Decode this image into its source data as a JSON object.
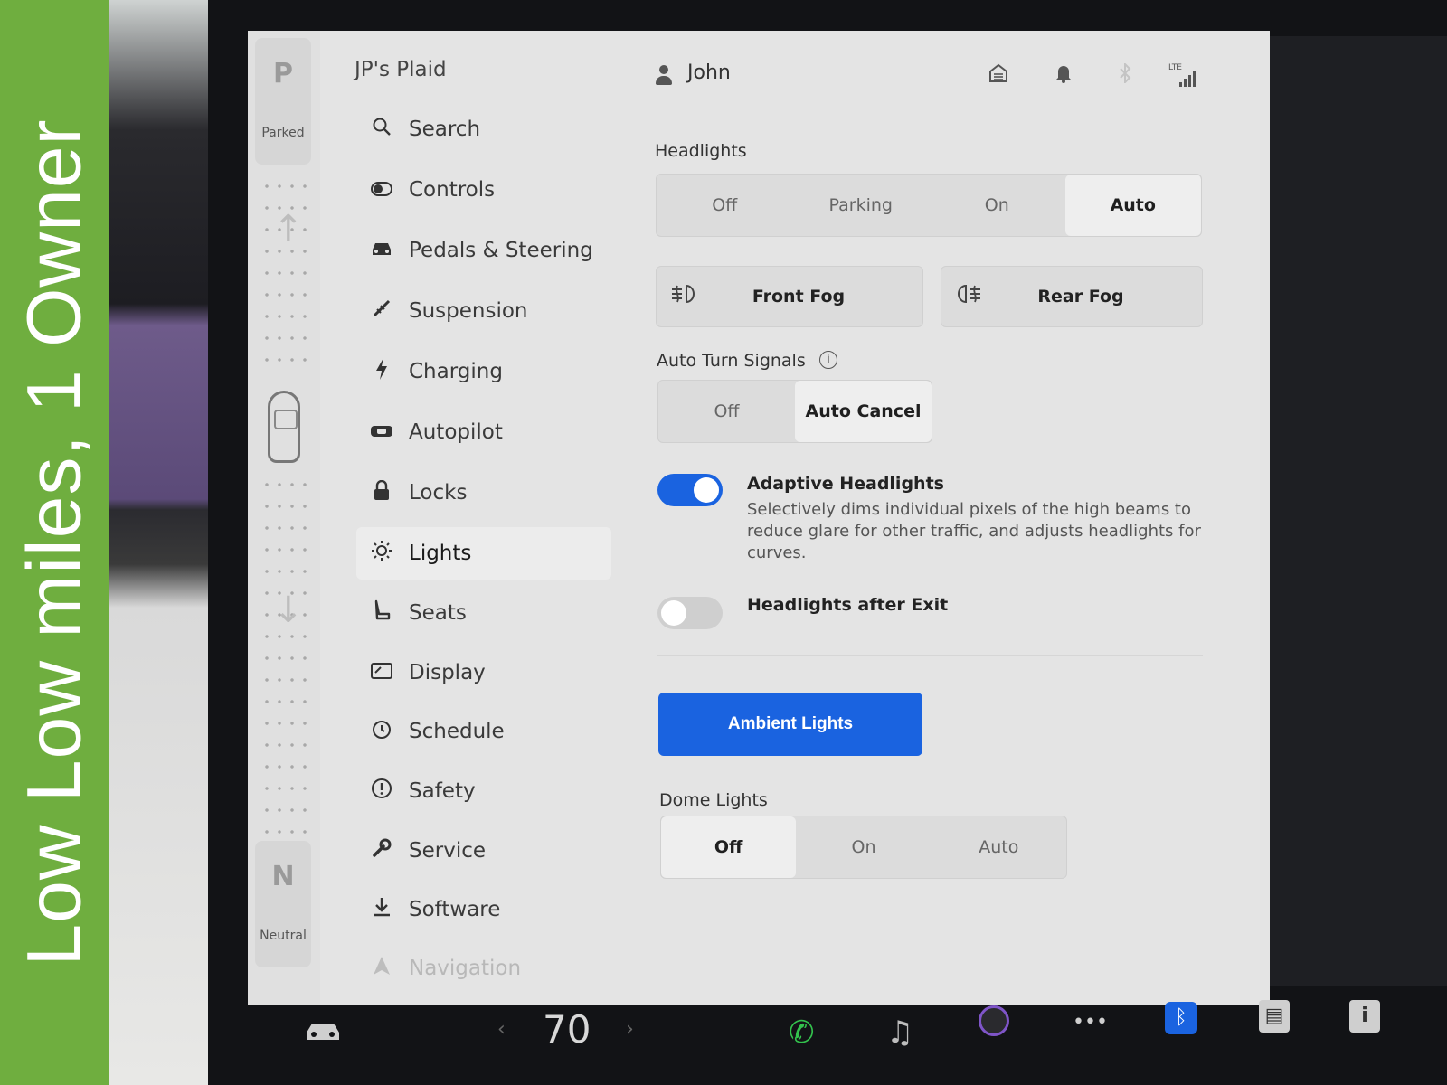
{
  "overlay": {
    "banner_text": "Low Low miles,   1 Owner"
  },
  "gear": {
    "top_letter": "P",
    "top_label": "Parked",
    "bottom_letter": "N",
    "bottom_label": "Neutral"
  },
  "sidebar": {
    "car_name": "JP's Plaid",
    "items": [
      {
        "label": "Search",
        "icon": "search-icon"
      },
      {
        "label": "Controls",
        "icon": "toggle-icon"
      },
      {
        "label": "Pedals & Steering",
        "icon": "car-icon"
      },
      {
        "label": "Suspension",
        "icon": "wrench-icon"
      },
      {
        "label": "Charging",
        "icon": "bolt-icon"
      },
      {
        "label": "Autopilot",
        "icon": "steering-icon"
      },
      {
        "label": "Locks",
        "icon": "lock-icon"
      },
      {
        "label": "Lights",
        "icon": "sun-icon",
        "active": true
      },
      {
        "label": "Seats",
        "icon": "seat-icon"
      },
      {
        "label": "Display",
        "icon": "display-icon"
      },
      {
        "label": "Schedule",
        "icon": "clock-icon"
      },
      {
        "label": "Safety",
        "icon": "alert-icon"
      },
      {
        "label": "Service",
        "icon": "wrench-icon"
      },
      {
        "label": "Software",
        "icon": "download-icon"
      },
      {
        "label": "Navigation",
        "icon": "navigation-icon"
      }
    ]
  },
  "status": {
    "user_name": "John",
    "network_label": "LTE"
  },
  "headlights": {
    "title": "Headlights",
    "options": [
      "Off",
      "Parking",
      "On",
      "Auto"
    ],
    "selected": "Auto"
  },
  "fog": {
    "front_label": "Front Fog",
    "rear_label": "Rear Fog"
  },
  "turn_signals": {
    "title": "Auto Turn Signals",
    "options": [
      "Off",
      "Auto Cancel"
    ],
    "selected": "Auto Cancel"
  },
  "adaptive": {
    "title": "Adaptive Headlights",
    "description": "Selectively dims individual pixels of the high beams to reduce glare for other traffic, and adjusts headlights for curves.",
    "enabled": true
  },
  "after_exit": {
    "title": "Headlights after Exit",
    "enabled": false
  },
  "ambient": {
    "label": "Ambient Lights"
  },
  "dome": {
    "title": "Dome Lights",
    "options": [
      "Off",
      "On",
      "Auto"
    ],
    "selected": "Off"
  },
  "taskbar": {
    "temperature": "70",
    "left_chevron": "‹",
    "right_chevron": "›"
  },
  "colors": {
    "accent": "#1a63e0",
    "banner": "#6fae3f",
    "phone": "#33c24d"
  }
}
